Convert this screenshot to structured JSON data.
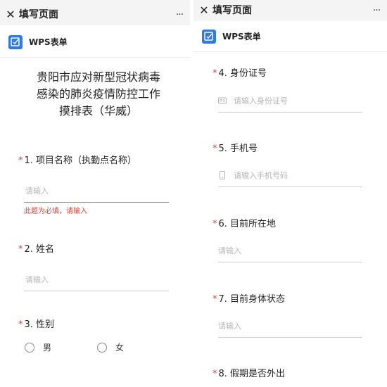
{
  "header": {
    "page_title": "填写页面",
    "close_glyph": "✕",
    "more_glyph": "···"
  },
  "brand": {
    "name": "WPS表单",
    "icon": "edit-form-icon",
    "icon_color": "#2f7be6"
  },
  "form": {
    "title_lines": [
      "贵阳市应对新型冠状病毒",
      "感染的肺炎疫情防控工作",
      "摸排表（华威）"
    ],
    "required_mark": "*",
    "error_color": "#e0413a",
    "questions": [
      {
        "label": "1. 项目名称（执勤点名称）",
        "placeholder": "请输入",
        "error": "此题为必填，请输入"
      },
      {
        "label": "2. 姓名",
        "placeholder": "请输入"
      },
      {
        "label": "3. 性别",
        "options": [
          "男",
          "女"
        ]
      },
      {
        "label": "4. 身份证号",
        "placeholder": "请输入身份证号",
        "icon": "id-card-icon"
      },
      {
        "label": "5. 手机号",
        "placeholder": "请输入手机号码",
        "icon": "phone-icon"
      },
      {
        "label": "6. 目前所在地",
        "placeholder": "请输入"
      },
      {
        "label": "7. 目前身体状态",
        "placeholder": "请输入"
      },
      {
        "label": "8. 假期是否外出"
      }
    ]
  }
}
